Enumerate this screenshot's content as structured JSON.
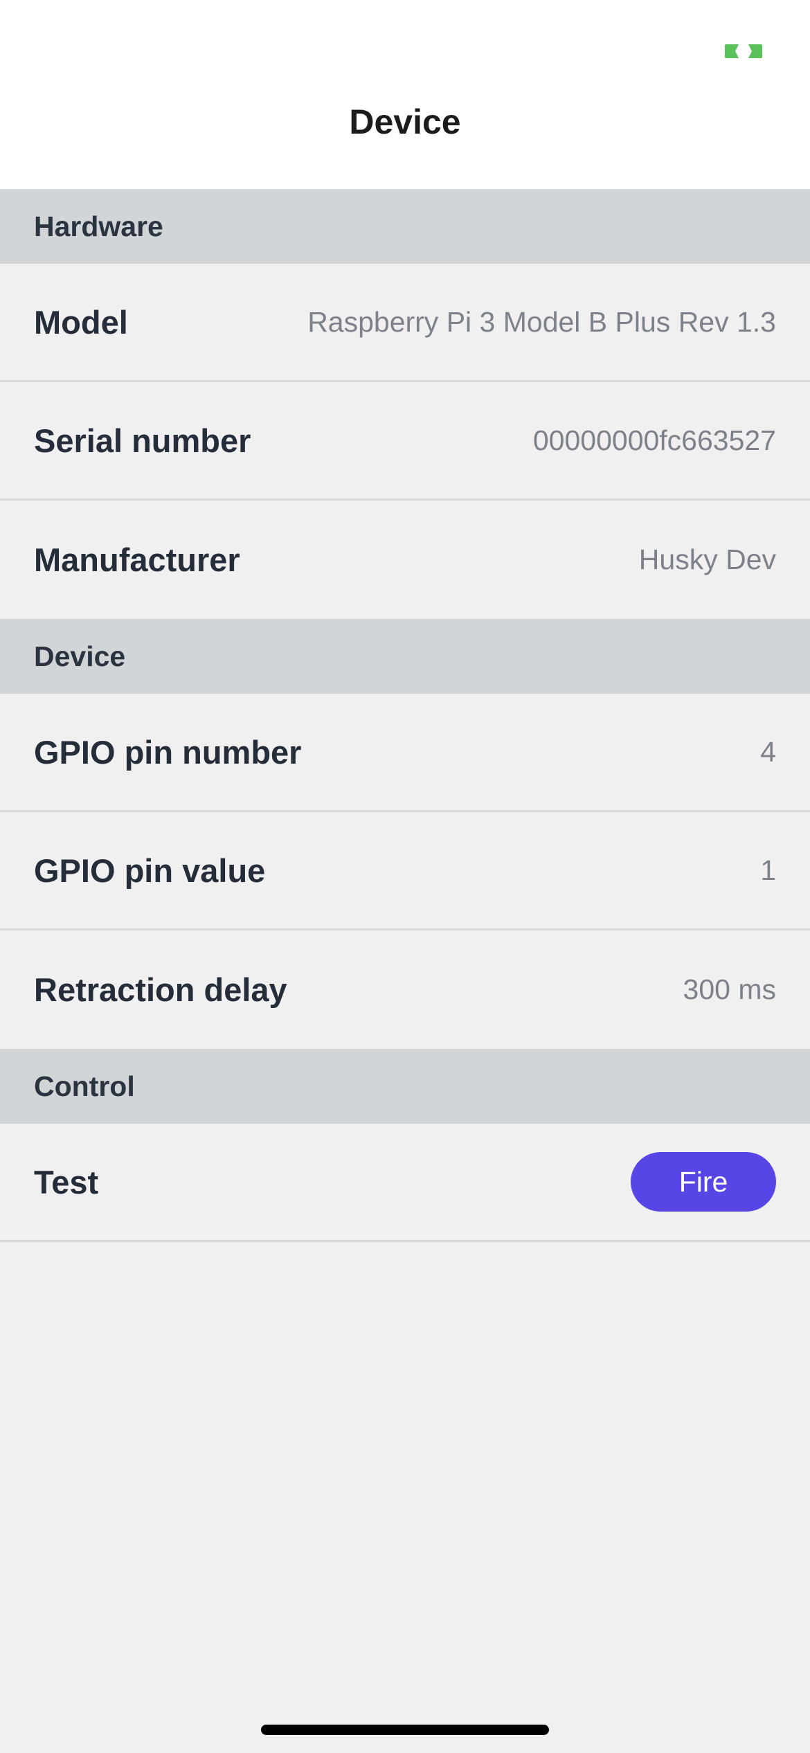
{
  "nav": {
    "title": "Device"
  },
  "status": {
    "indicator_icon": "status-indicator-icon",
    "indicator_color": "#5ac05a"
  },
  "sections": {
    "hardware": {
      "header": "Hardware",
      "rows": [
        {
          "label": "Model",
          "value": "Raspberry Pi 3 Model B Plus Rev 1.3"
        },
        {
          "label": "Serial number",
          "value": "00000000fc663527"
        },
        {
          "label": "Manufacturer",
          "value": "Husky Dev"
        }
      ]
    },
    "device": {
      "header": "Device",
      "rows": [
        {
          "label": "GPIO pin number",
          "value": "4"
        },
        {
          "label": "GPIO pin value",
          "value": "1"
        },
        {
          "label": "Retraction delay",
          "value": "300 ms"
        }
      ]
    },
    "control": {
      "header": "Control",
      "rows": [
        {
          "label": "Test",
          "button_label": "Fire"
        }
      ]
    }
  },
  "colors": {
    "accent": "#5745e6",
    "section_header_bg": "#d2d5d8",
    "background": "#f0f0f0"
  }
}
